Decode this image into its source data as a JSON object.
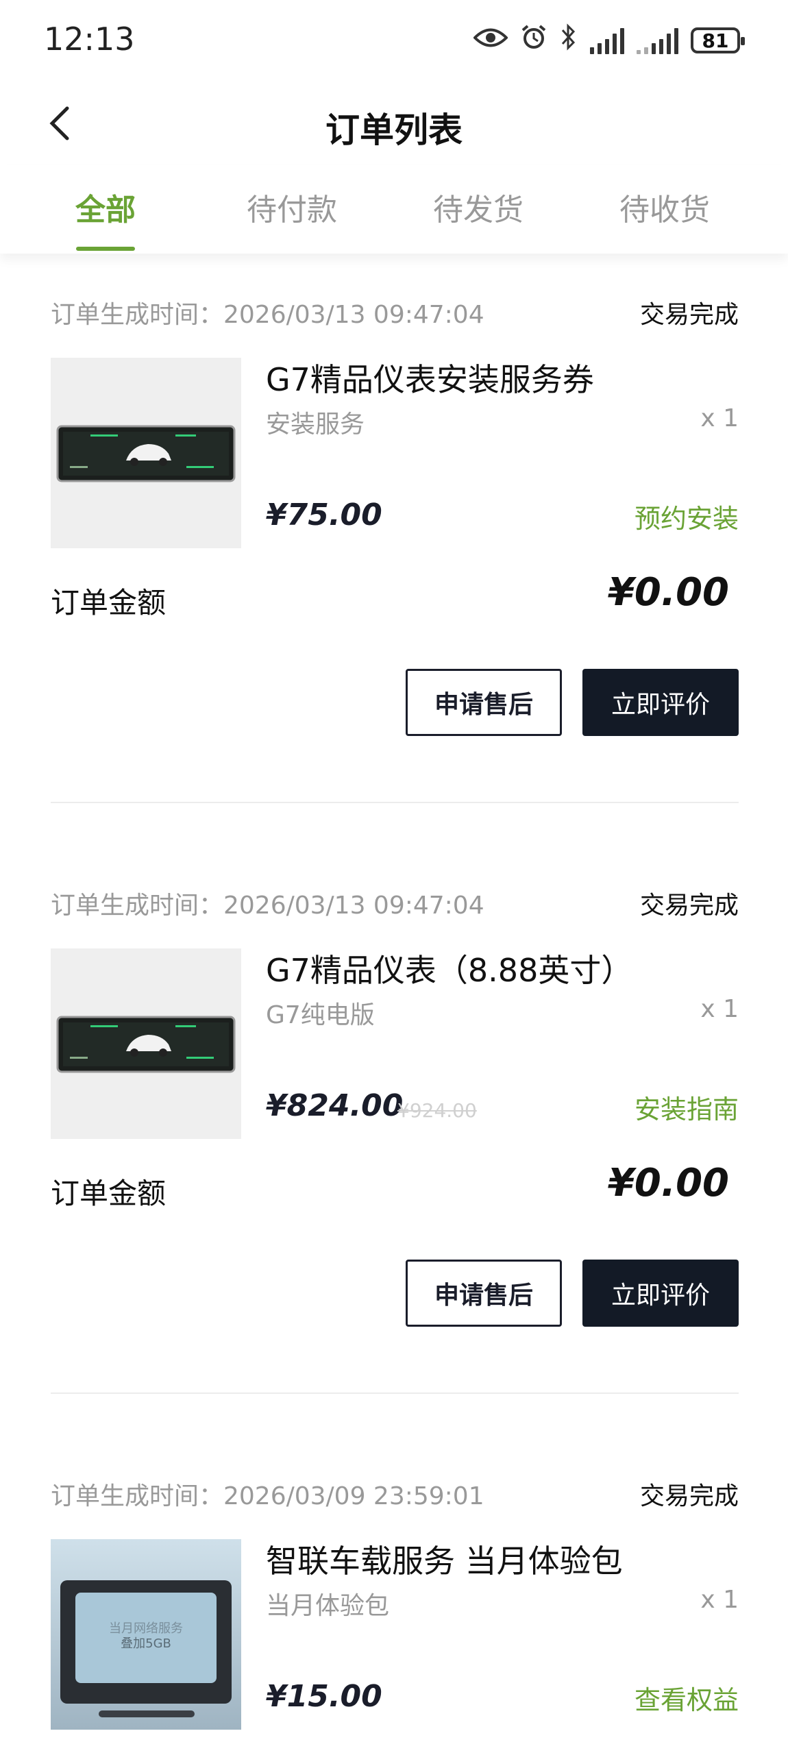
{
  "status_bar": {
    "time": "12:13",
    "battery": "81"
  },
  "header": {
    "title": "订单列表"
  },
  "tabs": [
    {
      "label": "全部",
      "active": true
    },
    {
      "label": "待付款",
      "active": false
    },
    {
      "label": "待发货",
      "active": false
    },
    {
      "label": "待收货",
      "active": false
    }
  ],
  "orders": [
    {
      "time": "订单生成时间：2026/03/13 09:47:04",
      "status": "交易完成",
      "name": "G7精品仪表安装服务券",
      "spec": "安装服务",
      "qty": "x 1",
      "price": "¥75.00",
      "link": "预约安装",
      "amount_label": "订单金额",
      "amount": "¥0.00",
      "btn_after_sale": "申请售后",
      "btn_review": "立即评价"
    },
    {
      "time": "订单生成时间：2026/03/13 09:47:04",
      "status": "交易完成",
      "name": "G7精品仪表（8.88英寸）",
      "spec": "G7纯电版",
      "qty": "x 1",
      "price": "¥824.00",
      "original_price": "¥924.00",
      "link": "安装指南",
      "amount_label": "订单金额",
      "amount": "¥0.00",
      "btn_after_sale": "申请售后",
      "btn_review": "立即评价"
    },
    {
      "time": "订单生成时间：2026/03/09 23:59:01",
      "status": "交易完成",
      "name": "智联车载服务 当月体验包",
      "spec": "当月体验包",
      "qty": "x 1",
      "price": "¥15.00",
      "link": "查看权益",
      "thumb_text_1": "当月网络服务",
      "thumb_text_2": "叠加5GB"
    }
  ],
  "colors": {
    "accent": "#6aa335",
    "dark_button": "#131a26",
    "muted": "#999999"
  }
}
